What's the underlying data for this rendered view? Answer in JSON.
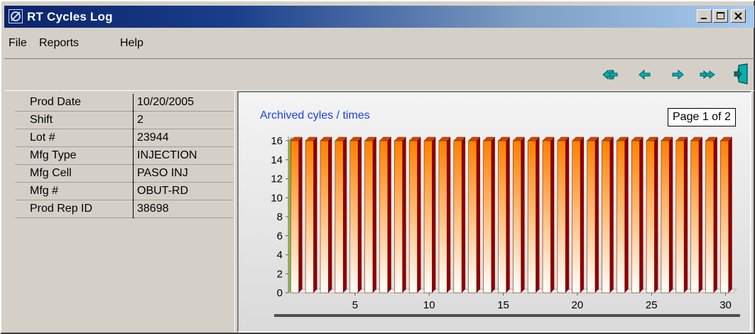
{
  "window": {
    "title": "RT Cycles Log"
  },
  "menu": {
    "file": "File",
    "reports": "Reports",
    "help": "Help"
  },
  "info": [
    {
      "label": "Prod Date",
      "value": "10/20/2005"
    },
    {
      "label": "Shift",
      "value": "2"
    },
    {
      "label": "Lot #",
      "value": "23944"
    },
    {
      "label": "Mfg Type",
      "value": "INJECTION"
    },
    {
      "label": "Mfg Cell",
      "value": "PASO INJ"
    },
    {
      "label": "Mfg #",
      "value": "OBUT-RD"
    },
    {
      "label": "Prod Rep ID",
      "value": "38698"
    }
  ],
  "toolbar": {
    "icons": [
      "first-page-icon",
      "previous-page-icon",
      "next-page-icon",
      "last-page-icon",
      "exit-door-icon"
    ],
    "icon_color": "#00a8a8"
  },
  "chart_panel": {
    "page_label": "Page 1 of 2"
  },
  "chart_data": {
    "type": "bar",
    "title": "Archived cyles / times",
    "x": [
      1,
      2,
      3,
      4,
      5,
      6,
      7,
      8,
      9,
      10,
      11,
      12,
      13,
      14,
      15,
      16,
      17,
      18,
      19,
      20,
      21,
      22,
      23,
      24,
      25,
      26,
      27,
      28,
      29,
      30
    ],
    "values": [
      16,
      16,
      16,
      16,
      16,
      16,
      16,
      16,
      16,
      16,
      16,
      16,
      16,
      16,
      16,
      16,
      16,
      16,
      16,
      16,
      16,
      16,
      16,
      16,
      16,
      16,
      16,
      16,
      16,
      16
    ],
    "ylim": [
      0,
      16
    ],
    "yticks": [
      0,
      2,
      4,
      6,
      8,
      10,
      12,
      14,
      16
    ],
    "xticks": [
      5,
      10,
      15,
      20,
      25,
      30
    ],
    "bar_color_top": "#ff8000",
    "bar_color_bottom": "#ffffff",
    "bar_side_color": "#8b0000",
    "bar_top_color": "#c84a00",
    "wall_color": "#80c040"
  }
}
